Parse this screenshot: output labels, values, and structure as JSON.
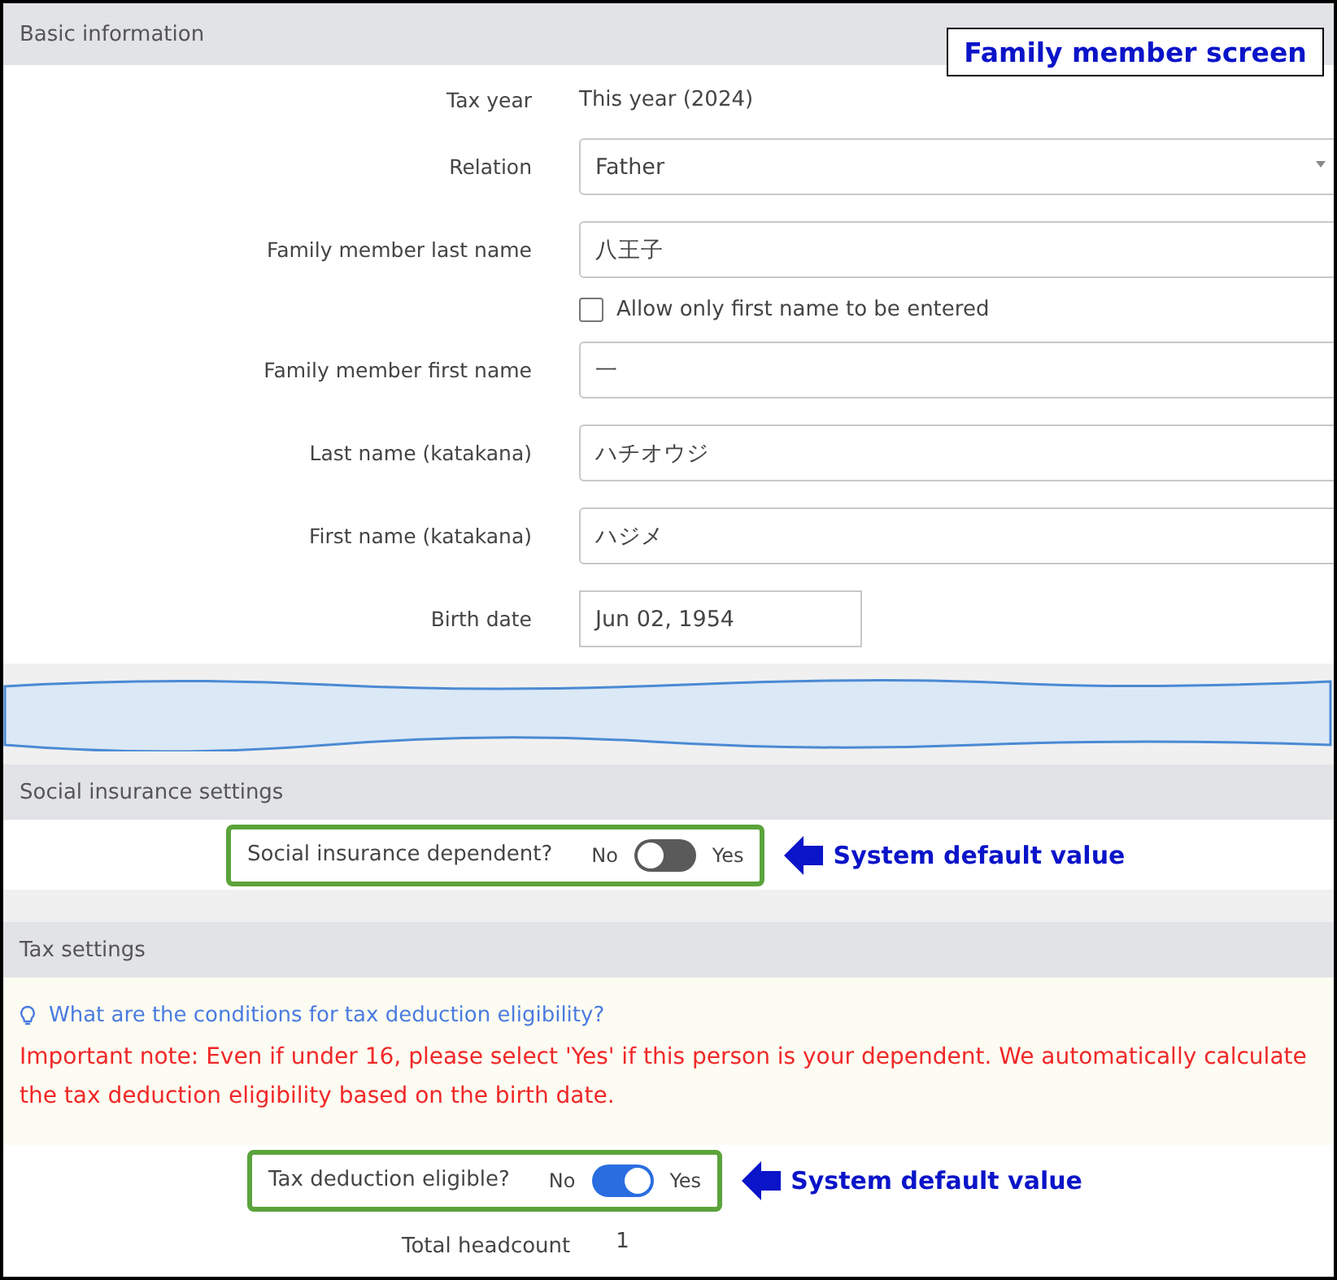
{
  "annotation_title": "Family member screen",
  "basic_information": {
    "title": "Basic information",
    "fields": [
      {
        "kind": "text",
        "label": "Tax year",
        "value": "This year (2024)"
      },
      {
        "kind": "select",
        "label": "Relation",
        "value": "Father"
      },
      {
        "kind": "input",
        "label": "Family member last name",
        "value": "八王子"
      },
      {
        "kind": "checkbox",
        "option": "Allow only first name to be entered",
        "checked": false
      },
      {
        "kind": "input",
        "label": "Family member first name",
        "value": "一"
      },
      {
        "kind": "input",
        "label": "Last name (katakana)",
        "value": "ハチオウジ"
      },
      {
        "kind": "input",
        "label": "First name (katakana)",
        "value": "ハジメ"
      },
      {
        "kind": "date",
        "label": "Birth date",
        "value": "Jun 02, 1954"
      }
    ]
  },
  "social_insurance": {
    "title": "Social insurance settings",
    "toggle": {
      "label": "Social insurance dependent?",
      "off_label": "No",
      "on_label": "Yes",
      "on": false
    },
    "callout": "System default value"
  },
  "tax": {
    "title": "Tax settings",
    "help_link": "What are the conditions for tax deduction eligibility?",
    "note": "Important note: Even if under 16, please select 'Yes' if this person is your dependent. We automatically calculate the tax deduction eligibility based on the birth date.",
    "toggle": {
      "label": "Tax deduction eligible?",
      "off_label": "No",
      "on_label": "Yes",
      "on": true
    },
    "callout": "System default value",
    "headcount": {
      "label": "Total headcount",
      "value": "1"
    }
  }
}
